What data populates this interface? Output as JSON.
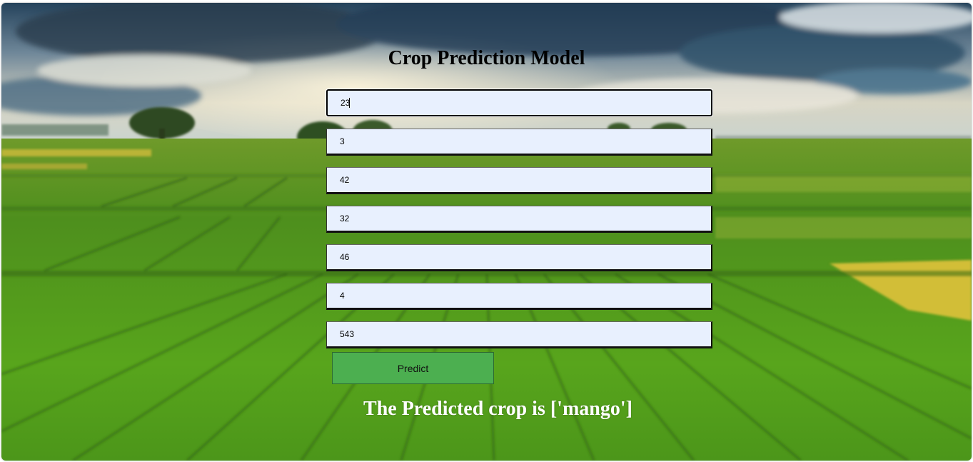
{
  "page": {
    "title": "Crop Prediction Model"
  },
  "form": {
    "fields": [
      {
        "value": "23"
      },
      {
        "value": "3"
      },
      {
        "value": "42"
      },
      {
        "value": "32"
      },
      {
        "value": "46"
      },
      {
        "value": "4"
      },
      {
        "value": "543"
      }
    ],
    "predict_label": "Predict"
  },
  "result": {
    "text": "The Predicted crop is ['mango']"
  },
  "colors": {
    "field_background": "#e8f0fe",
    "button_background": "#4caf50",
    "result_text": "#ffffff",
    "title_text": "#000000"
  }
}
